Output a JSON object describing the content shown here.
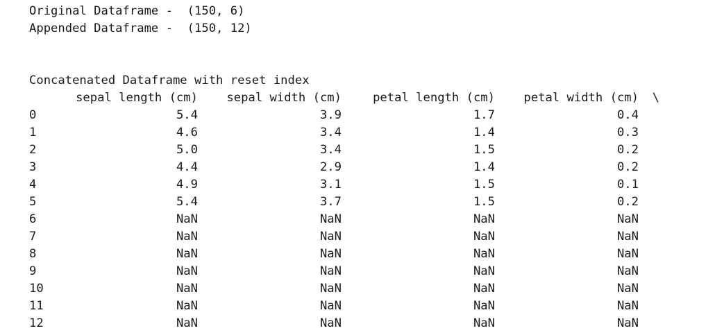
{
  "summary": {
    "original": "Original Dataframe -  (150, 6)",
    "appended": "Appended Dataframe -  (150, 12)"
  },
  "concat_title": "Concatenated Dataframe with reset index",
  "table": {
    "columns": [
      "sepal length (cm)",
      "sepal width (cm)",
      "petal length (cm)",
      "petal width (cm)"
    ],
    "continuation": "\\",
    "rows": [
      {
        "index": "0",
        "values": [
          "5.4",
          "3.9",
          "1.7",
          "0.4"
        ]
      },
      {
        "index": "1",
        "values": [
          "4.6",
          "3.4",
          "1.4",
          "0.3"
        ]
      },
      {
        "index": "2",
        "values": [
          "5.0",
          "3.4",
          "1.5",
          "0.2"
        ]
      },
      {
        "index": "3",
        "values": [
          "4.4",
          "2.9",
          "1.4",
          "0.2"
        ]
      },
      {
        "index": "4",
        "values": [
          "4.9",
          "3.1",
          "1.5",
          "0.1"
        ]
      },
      {
        "index": "5",
        "values": [
          "5.4",
          "3.7",
          "1.5",
          "0.2"
        ]
      },
      {
        "index": "6",
        "values": [
          "NaN",
          "NaN",
          "NaN",
          "NaN"
        ]
      },
      {
        "index": "7",
        "values": [
          "NaN",
          "NaN",
          "NaN",
          "NaN"
        ]
      },
      {
        "index": "8",
        "values": [
          "NaN",
          "NaN",
          "NaN",
          "NaN"
        ]
      },
      {
        "index": "9",
        "values": [
          "NaN",
          "NaN",
          "NaN",
          "NaN"
        ]
      },
      {
        "index": "10",
        "values": [
          "NaN",
          "NaN",
          "NaN",
          "NaN"
        ]
      },
      {
        "index": "11",
        "values": [
          "NaN",
          "NaN",
          "NaN",
          "NaN"
        ]
      },
      {
        "index": "12",
        "values": [
          "NaN",
          "NaN",
          "NaN",
          "NaN"
        ]
      }
    ]
  }
}
